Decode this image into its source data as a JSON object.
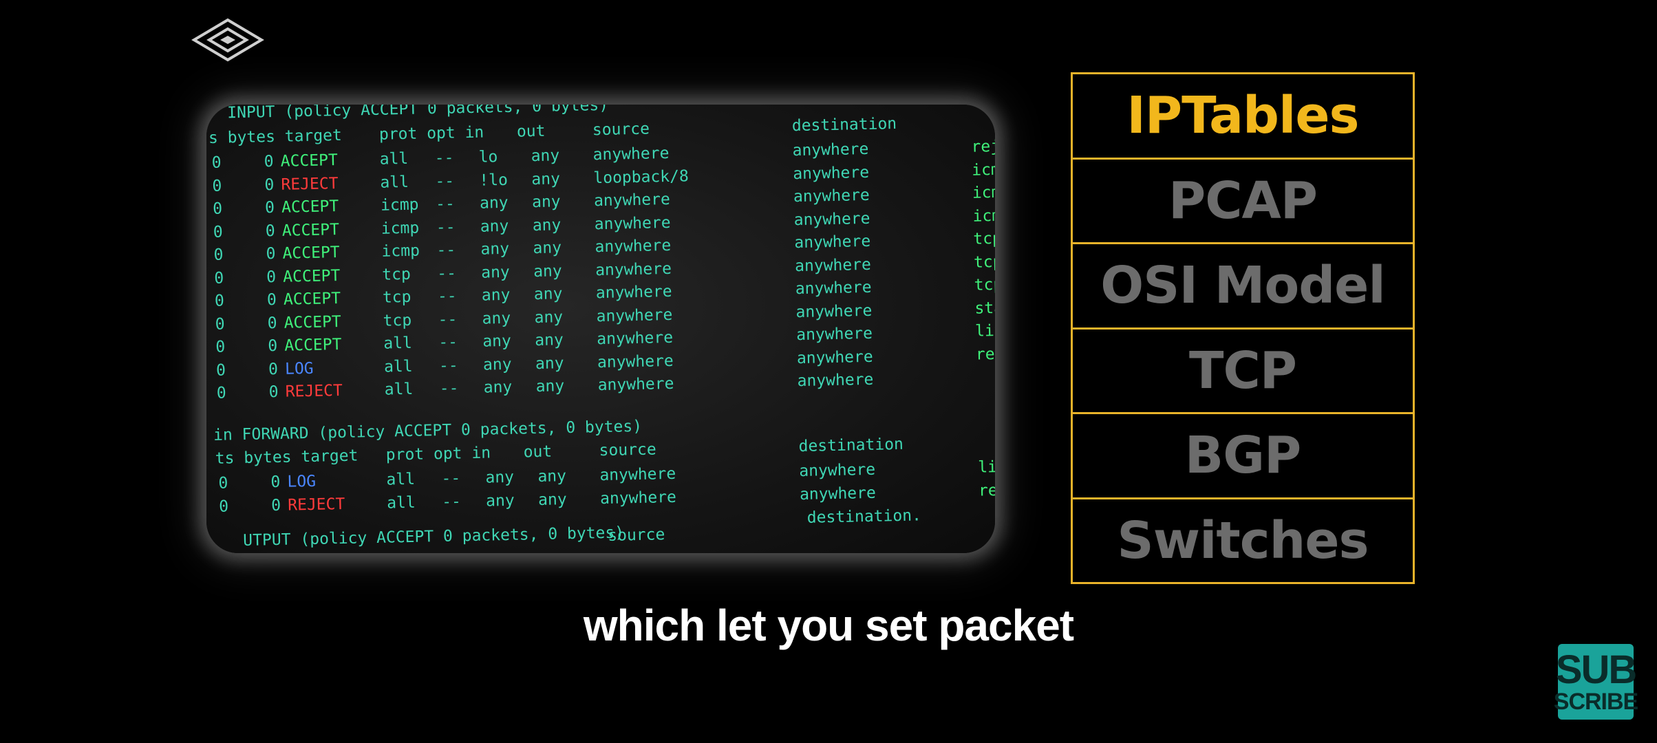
{
  "terminal": {
    "input_header": "INPUT (policy ACCEPT 0 packets, 0 bytes)",
    "col_header_1": "s bytes target",
    "col_header_2": "prot opt in",
    "col_header_3": "out",
    "col_header_4": "source",
    "col_header_5": "destination",
    "input_rows": [
      {
        "pkts": "0",
        "bytes": "0",
        "target": "ACCEPT",
        "tclass": "g",
        "prot": "all",
        "opt": "--",
        "in": "lo",
        "out": "any",
        "source": "anywhere",
        "dest": "anywhere",
        "extra": "rejec"
      },
      {
        "pkts": "0",
        "bytes": "0",
        "target": "REJECT",
        "tclass": "r",
        "prot": "all",
        "opt": "--",
        "in": "!lo",
        "out": "any",
        "source": "loopback/8",
        "dest": "anywhere",
        "extra": "icmp"
      },
      {
        "pkts": "0",
        "bytes": "0",
        "target": "ACCEPT",
        "tclass": "g",
        "prot": "icmp",
        "opt": "--",
        "in": "any",
        "out": "any",
        "source": "anywhere",
        "dest": "anywhere",
        "extra": "icmp"
      },
      {
        "pkts": "0",
        "bytes": "0",
        "target": "ACCEPT",
        "tclass": "g",
        "prot": "icmp",
        "opt": "--",
        "in": "any",
        "out": "any",
        "source": "anywhere",
        "dest": "anywhere",
        "extra": "icmp"
      },
      {
        "pkts": "0",
        "bytes": "0",
        "target": "ACCEPT",
        "tclass": "g",
        "prot": "icmp",
        "opt": "--",
        "in": "any",
        "out": "any",
        "source": "anywhere",
        "dest": "anywhere",
        "extra": "tcp d"
      },
      {
        "pkts": "0",
        "bytes": "0",
        "target": "ACCEPT",
        "tclass": "g",
        "prot": "tcp",
        "opt": "--",
        "in": "any",
        "out": "any",
        "source": "anywhere",
        "dest": "anywhere",
        "extra": "tcp d"
      },
      {
        "pkts": "0",
        "bytes": "0",
        "target": "ACCEPT",
        "tclass": "g",
        "prot": "tcp",
        "opt": "--",
        "in": "any",
        "out": "any",
        "source": "anywhere",
        "dest": "anywhere",
        "extra": "tcp d"
      },
      {
        "pkts": "0",
        "bytes": "0",
        "target": "ACCEPT",
        "tclass": "g",
        "prot": "tcp",
        "opt": "--",
        "in": "any",
        "out": "any",
        "source": "anywhere",
        "dest": "anywhere",
        "extra": "state"
      },
      {
        "pkts": "0",
        "bytes": "0",
        "target": "ACCEPT",
        "tclass": "g",
        "prot": "all",
        "opt": "--",
        "in": "any",
        "out": "any",
        "source": "anywhere",
        "dest": "anywhere",
        "extra": "limit"
      },
      {
        "pkts": "0",
        "bytes": "0",
        "target": "LOG",
        "tclass": "b",
        "prot": "all",
        "opt": "--",
        "in": "any",
        "out": "any",
        "source": "anywhere",
        "dest": "anywhere",
        "extra": "rejec"
      },
      {
        "pkts": "0",
        "bytes": "0",
        "target": "REJECT",
        "tclass": "r",
        "prot": "all",
        "opt": "--",
        "in": "any",
        "out": "any",
        "source": "anywhere",
        "dest": "anywhere",
        "extra": ""
      }
    ],
    "forward_header": "in FORWARD (policy ACCEPT 0 packets, 0 bytes)",
    "fwd_col_header_1": "ts bytes target",
    "fwd_col_header_2": "prot opt in",
    "fwd_col_header_3": "out",
    "fwd_col_header_4": "source",
    "fwd_col_header_5": "destination",
    "forward_rows": [
      {
        "pkts": "0",
        "bytes": "0",
        "target": "LOG",
        "tclass": "b",
        "prot": "all",
        "opt": "--",
        "in": "any",
        "out": "any",
        "source": "anywhere",
        "dest": "anywhere",
        "extra": "limit"
      },
      {
        "pkts": "0",
        "bytes": "0",
        "target": "REJECT",
        "tclass": "r",
        "prot": "all",
        "opt": "--",
        "in": "any",
        "out": "any",
        "source": "anywhere",
        "dest": "anywhere",
        "extra": "rejec"
      }
    ],
    "output_header": "UTPUT (policy ACCEPT 0 packets, 0 bytes)",
    "output_source": "source",
    "output_dest": "destination."
  },
  "topics": [
    "IPTables",
    "PCAP",
    "OSI Model",
    "TCP",
    "BGP",
    "Switches"
  ],
  "active_topic": "IPTables",
  "caption": "which let you set packet",
  "subscribe": {
    "line1": "SUB",
    "line2": "SCRIBE"
  },
  "colors": {
    "accent": "#e9b32a",
    "active_text": "#f2b71c",
    "inactive_text": "#6c6c6c",
    "subscribe_bg": "#1aa39a"
  }
}
